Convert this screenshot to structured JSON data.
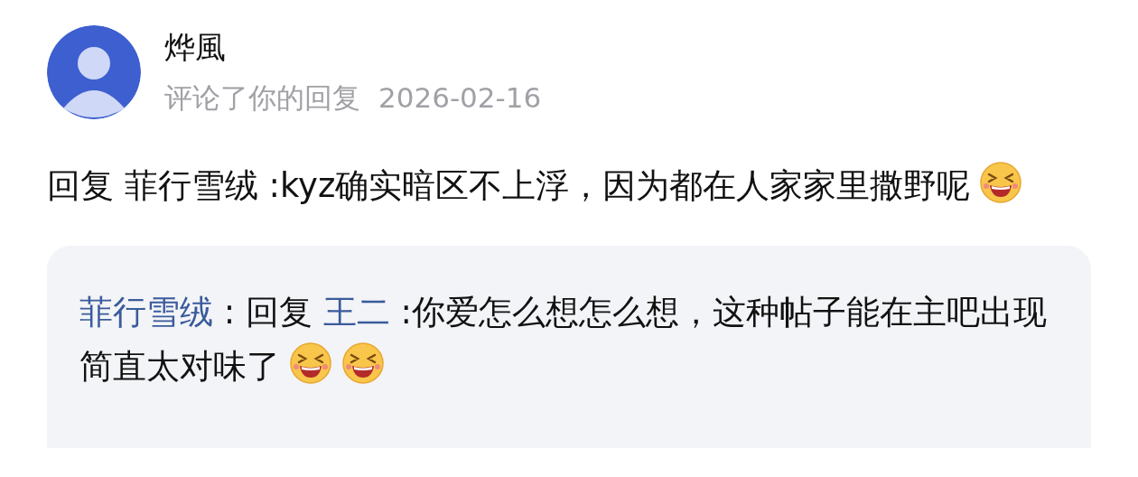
{
  "comment": {
    "author": "烨風",
    "action": "评论了你的回复",
    "date": "2026-02-16",
    "content": [
      {
        "kind": "text",
        "text": "回复 菲行雪绒 :kyz确实暗区不上浮，因为都在人家家里撒野呢"
      },
      {
        "kind": "emoji"
      }
    ]
  },
  "quote": {
    "content": [
      {
        "kind": "link",
        "text": "菲行雪绒"
      },
      {
        "kind": "text",
        "text": " : 回复 "
      },
      {
        "kind": "link",
        "text": "王二"
      },
      {
        "kind": "text",
        "text": "  :你爱怎么想怎么想，这种帖子能在主吧出现简直太对味了"
      },
      {
        "kind": "emoji"
      },
      {
        "kind": "emoji"
      }
    ]
  }
}
